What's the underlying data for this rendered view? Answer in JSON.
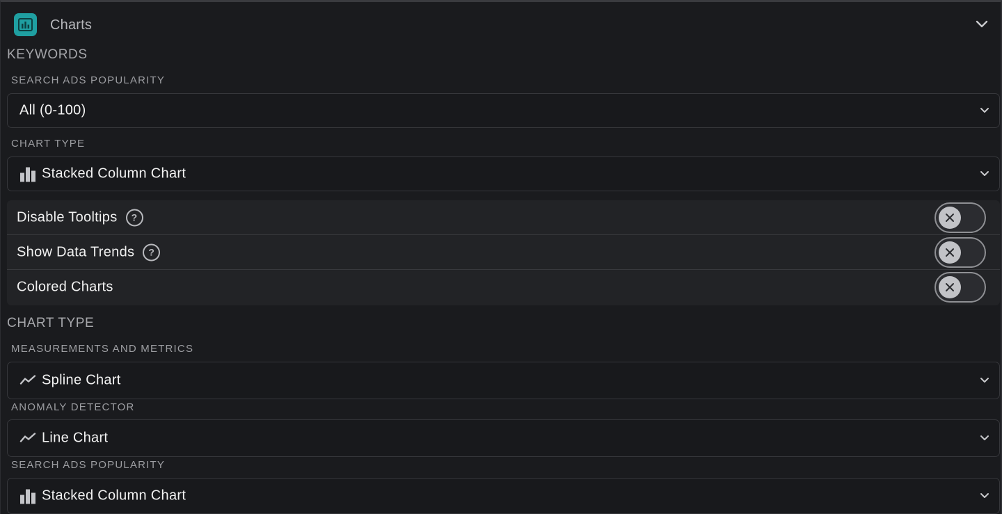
{
  "header": {
    "title": "Charts",
    "icon": "chart-icon",
    "accent_color": "#1f9fa1"
  },
  "keywords_section": {
    "title": "KEYWORDS",
    "search_ads_popularity": {
      "label": "SEARCH ADS POPULARITY",
      "value": "All (0-100)"
    },
    "chart_type": {
      "label": "CHART TYPE",
      "value": "Stacked Column Chart",
      "icon": "bar-chart-icon"
    }
  },
  "toggles": [
    {
      "label": "Disable Tooltips",
      "help": "?",
      "enabled": false
    },
    {
      "label": "Show Data Trends",
      "help": "?",
      "enabled": false
    },
    {
      "label": "Colored Charts",
      "enabled": false
    }
  ],
  "chart_type_section": {
    "title": "CHART TYPE",
    "fields": [
      {
        "label": "MEASUREMENTS AND METRICS",
        "value": "Spline Chart",
        "icon": "line-chart-icon"
      },
      {
        "label": "ANOMALY DETECTOR",
        "value": "Line Chart",
        "icon": "line-chart-icon"
      },
      {
        "label": "SEARCH ADS POPULARITY",
        "value": "Stacked Column Chart",
        "icon": "bar-chart-icon"
      }
    ]
  }
}
